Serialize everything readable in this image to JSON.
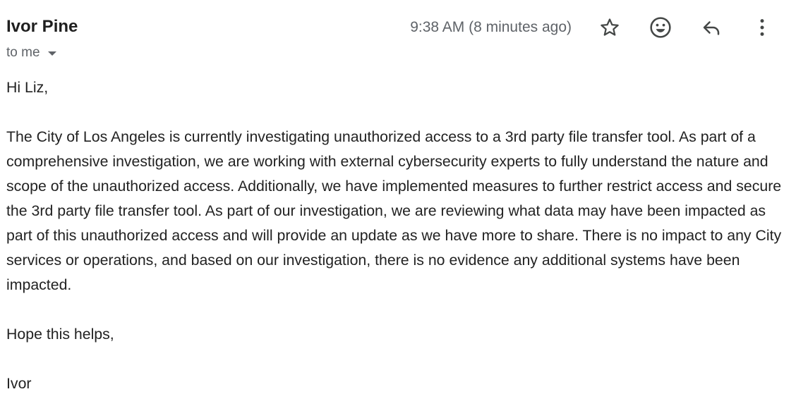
{
  "message": {
    "sender_name": "Ivor Pine",
    "recipient_label": "to me",
    "timestamp": "9:38 AM (8 minutes ago)",
    "actions": {
      "star_icon": "star-outline-icon",
      "emoji_icon": "smiley-icon",
      "reply_icon": "reply-arrow-icon",
      "more_icon": "vertical-dots-icon"
    },
    "body": {
      "greeting": "Hi Liz,",
      "paragraph": "The City of Los Angeles is currently investigating unauthorized access to a 3rd party file transfer tool. As part of a comprehensive investigation, we are working with external cybersecurity experts to fully understand the nature and scope of the unauthorized access. Additionally, we have implemented measures to further restrict access and secure the 3rd party file transfer tool. As part of our investigation, we are reviewing what data may have been impacted as part of this unauthorized access and will provide an update as we have more to share. There is no impact to any City services or operations, and based on our investigation, there is no evidence any additional systems have been impacted.",
      "closing": "Hope this helps,",
      "signature": "Ivor"
    }
  },
  "colors": {
    "text": "#222222",
    "secondary_text": "#5f6368",
    "icon": "#444746"
  }
}
